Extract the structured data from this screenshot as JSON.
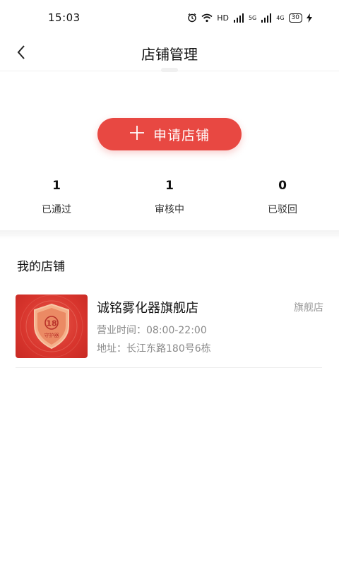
{
  "status_bar": {
    "time": "15:03",
    "hd_label": "HD",
    "signal1_label": "5G",
    "signal2_label": "4G",
    "battery": "30",
    "icons": [
      "alarm-icon",
      "wifi-icon",
      "signal-icon",
      "signal-icon",
      "battery-icon",
      "charging-icon"
    ]
  },
  "nav": {
    "title": "店铺管理",
    "back_icon": "chevron-left-icon"
  },
  "apply_button": {
    "icon": "plus-icon",
    "label": "申请店铺",
    "color": "#e84842"
  },
  "stats": [
    {
      "value": "1",
      "label": "已通过"
    },
    {
      "value": "1",
      "label": "审核中"
    },
    {
      "value": "0",
      "label": "已驳回"
    }
  ],
  "my_stores": {
    "title": "我的店铺",
    "items": [
      {
        "name": "诚铭雾化器旗舰店",
        "type": "旗舰店",
        "hours": "营业时间：08:00-22:00",
        "address": "地址：长江东路180号6栋",
        "thumbnail": {
          "badge_number": "18",
          "badge_text": "守护器",
          "icon": "shield-badge-icon"
        }
      }
    ]
  }
}
